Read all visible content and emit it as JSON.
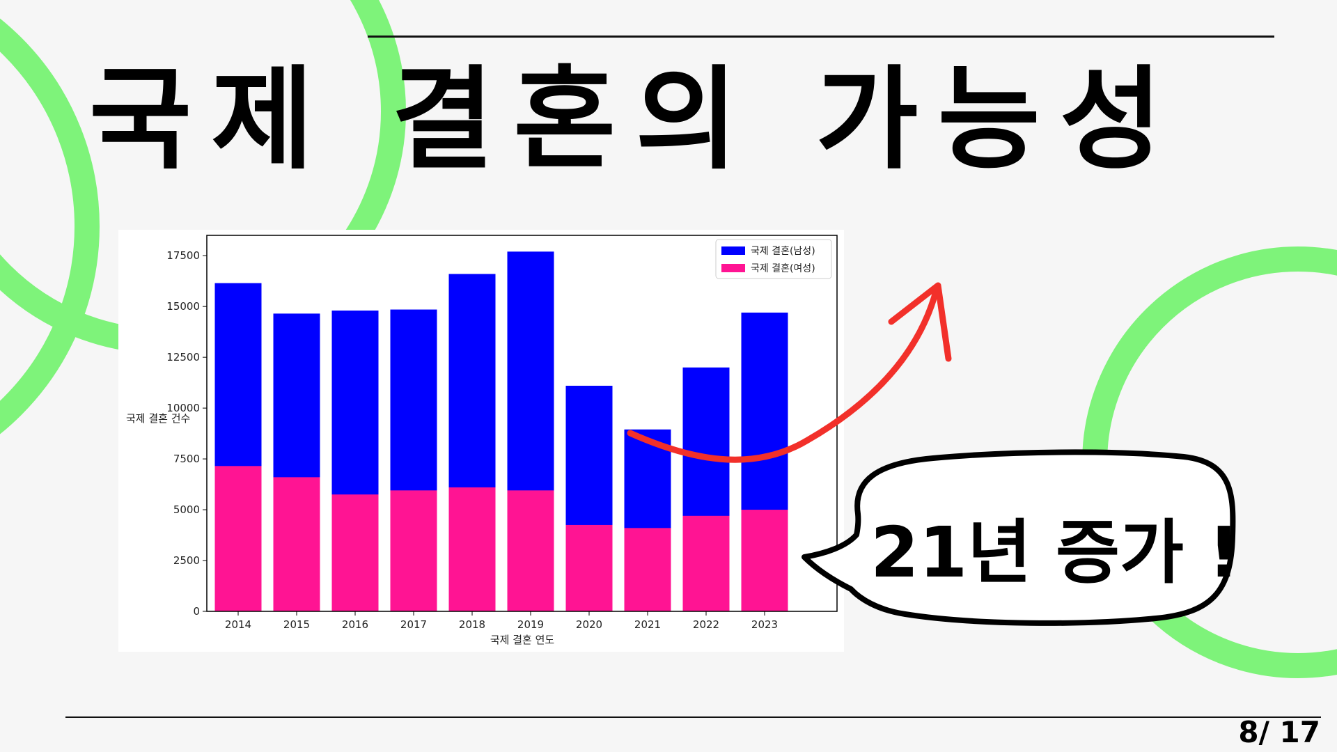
{
  "slide": {
    "title": "국제 결혼의 가능성",
    "page_number": "8/ 17",
    "callout": "21년 증가 !",
    "accent_color": "#7ef37a",
    "arrow_color": "#f2302a"
  },
  "chart_data": {
    "type": "bar",
    "stacked": true,
    "categories": [
      "2014",
      "2015",
      "2016",
      "2017",
      "2018",
      "2019",
      "2020",
      "2021",
      "2022",
      "2023"
    ],
    "series": [
      {
        "name": "국제 결혼(남성)",
        "color": "#0000ff",
        "values": [
          16150,
          14650,
          14800,
          14850,
          16600,
          17700,
          11100,
          8950,
          12000,
          14700
        ]
      },
      {
        "name": "국제 결혼(여성)",
        "color": "#ff1493",
        "values": [
          7150,
          6600,
          5750,
          5950,
          6100,
          5950,
          4250,
          4100,
          4700,
          5000
        ]
      }
    ],
    "xlabel": "국제 결혼 연도",
    "ylabel": "국제 결혼 건수",
    "ylim": [
      0,
      18500
    ],
    "yticks": [
      "0",
      "2500",
      "5000",
      "7500",
      "10000",
      "12500",
      "15000",
      "17500"
    ],
    "grid": false,
    "legend": "top-right"
  }
}
